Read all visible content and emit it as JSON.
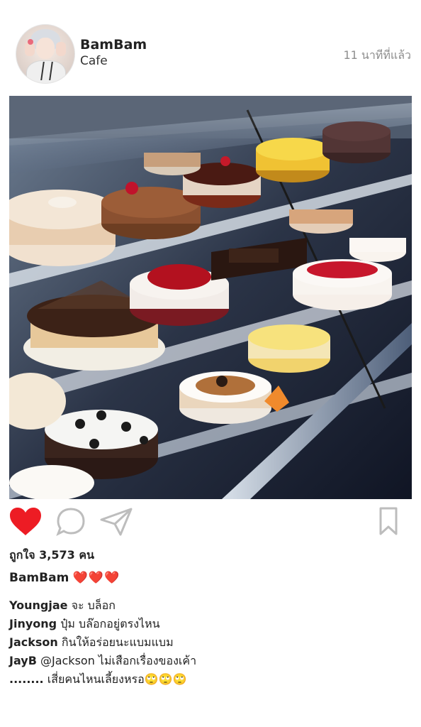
{
  "post": {
    "username": "BamBam",
    "location": "Cafe",
    "time_ago": "11 นาทีที่แล้ว",
    "photo_description_icon": "cake-display-photo"
  },
  "actions": {
    "like_icon": "heart-filled-icon",
    "comment_icon": "comment-bubble-icon",
    "share_icon": "paper-plane-icon",
    "save_icon": "bookmark-icon",
    "like_color": "#ed1c24"
  },
  "likes_text": "ถูกใจ 3,573 คน",
  "caption": {
    "user": "BamBam",
    "text": "❤️❤️❤️"
  },
  "comments": [
    {
      "user": "Youngjae",
      "text": "จะ บล็อก"
    },
    {
      "user": "Jinyong",
      "text": "ปุ๋ม บล๊อกอยู่ตรงไหน"
    },
    {
      "user": "Jackson",
      "text": "กินให้อร่อยนะแบมแบม"
    },
    {
      "user": "JayB",
      "text": "@Jackson ไม่เสือกเรื่องของเค้า"
    },
    {
      "user": "........",
      "text": "เสี่ยคนไหนเลี้ยงหรอ🙄🙄🙄"
    }
  ]
}
